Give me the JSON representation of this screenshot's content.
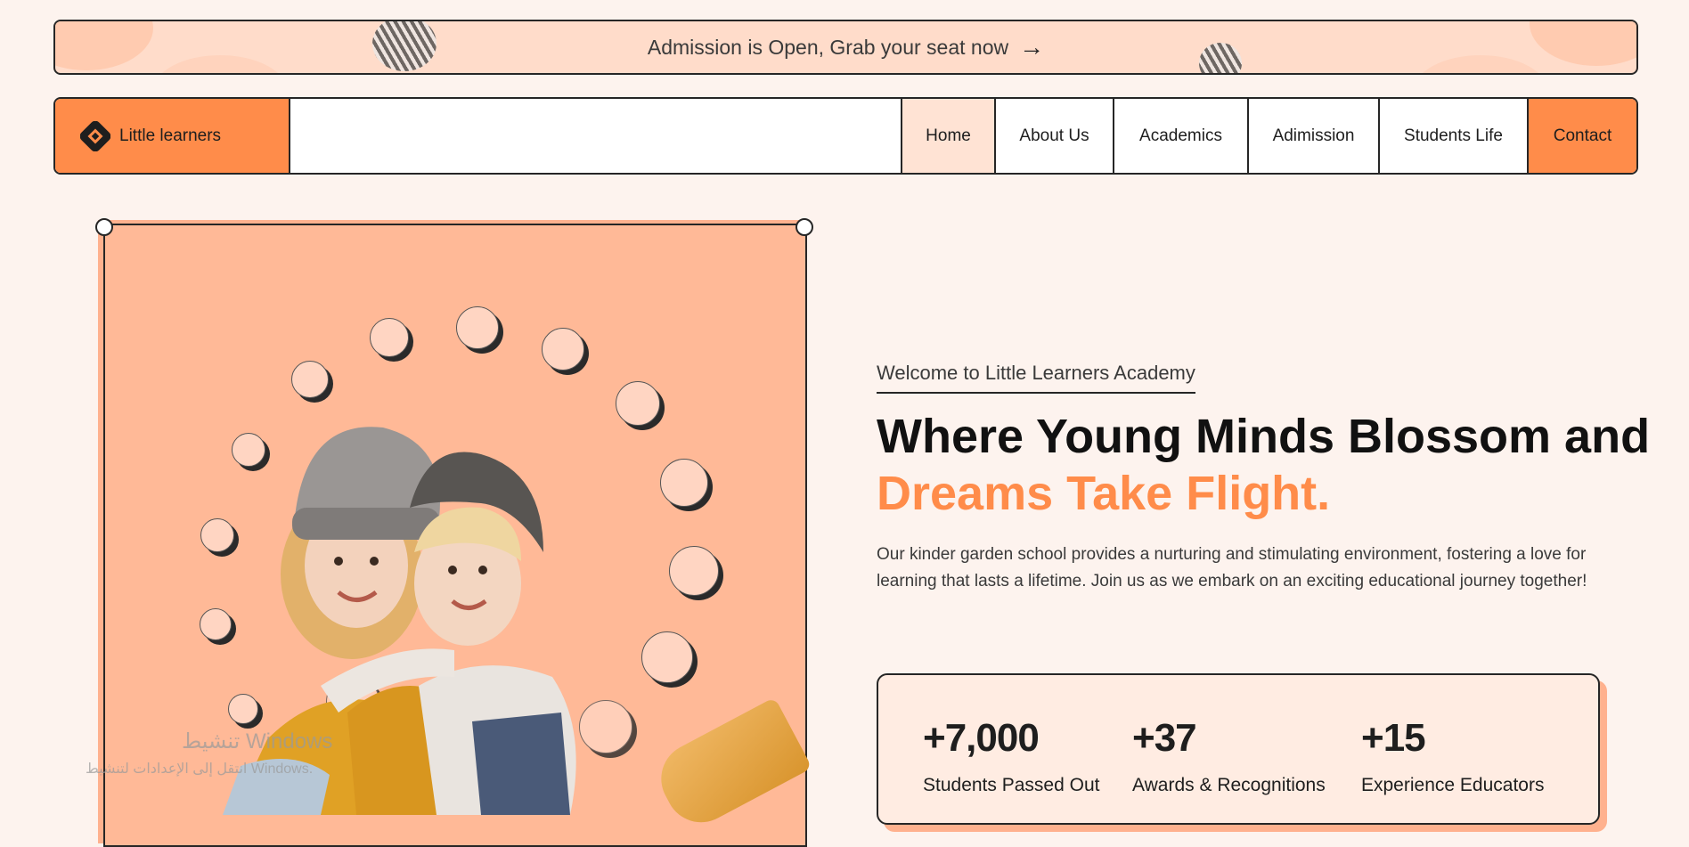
{
  "banner": {
    "text": "Admission is Open, Grab your seat now",
    "arrow_icon": "arrow-right-icon"
  },
  "navbar": {
    "brand": {
      "name": "Little learners",
      "logo_icon": "diamond-logo-icon"
    },
    "items": [
      {
        "label": "Home"
      },
      {
        "label": "About Us"
      },
      {
        "label": "Academics"
      },
      {
        "label": "Adimission"
      },
      {
        "label": "Students Life"
      },
      {
        "label": "Contact"
      }
    ]
  },
  "hero": {
    "welcome": "Welcome to Little Learners Academy",
    "headline_line1": "Where Young Minds Blossom and",
    "headline_line2": "Dreams Take Flight.",
    "description": "Our kinder garden school provides a nurturing and stimulating environment, fostering a love for learning that lasts a lifetime. Join us as we embark on an exciting educational journey together!"
  },
  "stats": [
    {
      "value": "+7,000",
      "label": "Students Passed Out"
    },
    {
      "value": "+37",
      "label": "Awards & Recognitions"
    },
    {
      "value": "+15",
      "label": "Experience Educators"
    }
  ],
  "watermark": {
    "line1": "تنشيط Windows",
    "line2": "انتقل إلى الإعدادات لتنشيط Windows."
  },
  "colors": {
    "accent": "#ff8c4a",
    "background": "#fdf3ee",
    "banner": "#ffdcca",
    "card": "#ffb997",
    "stats_card": "#ffece2",
    "border": "#262626"
  }
}
